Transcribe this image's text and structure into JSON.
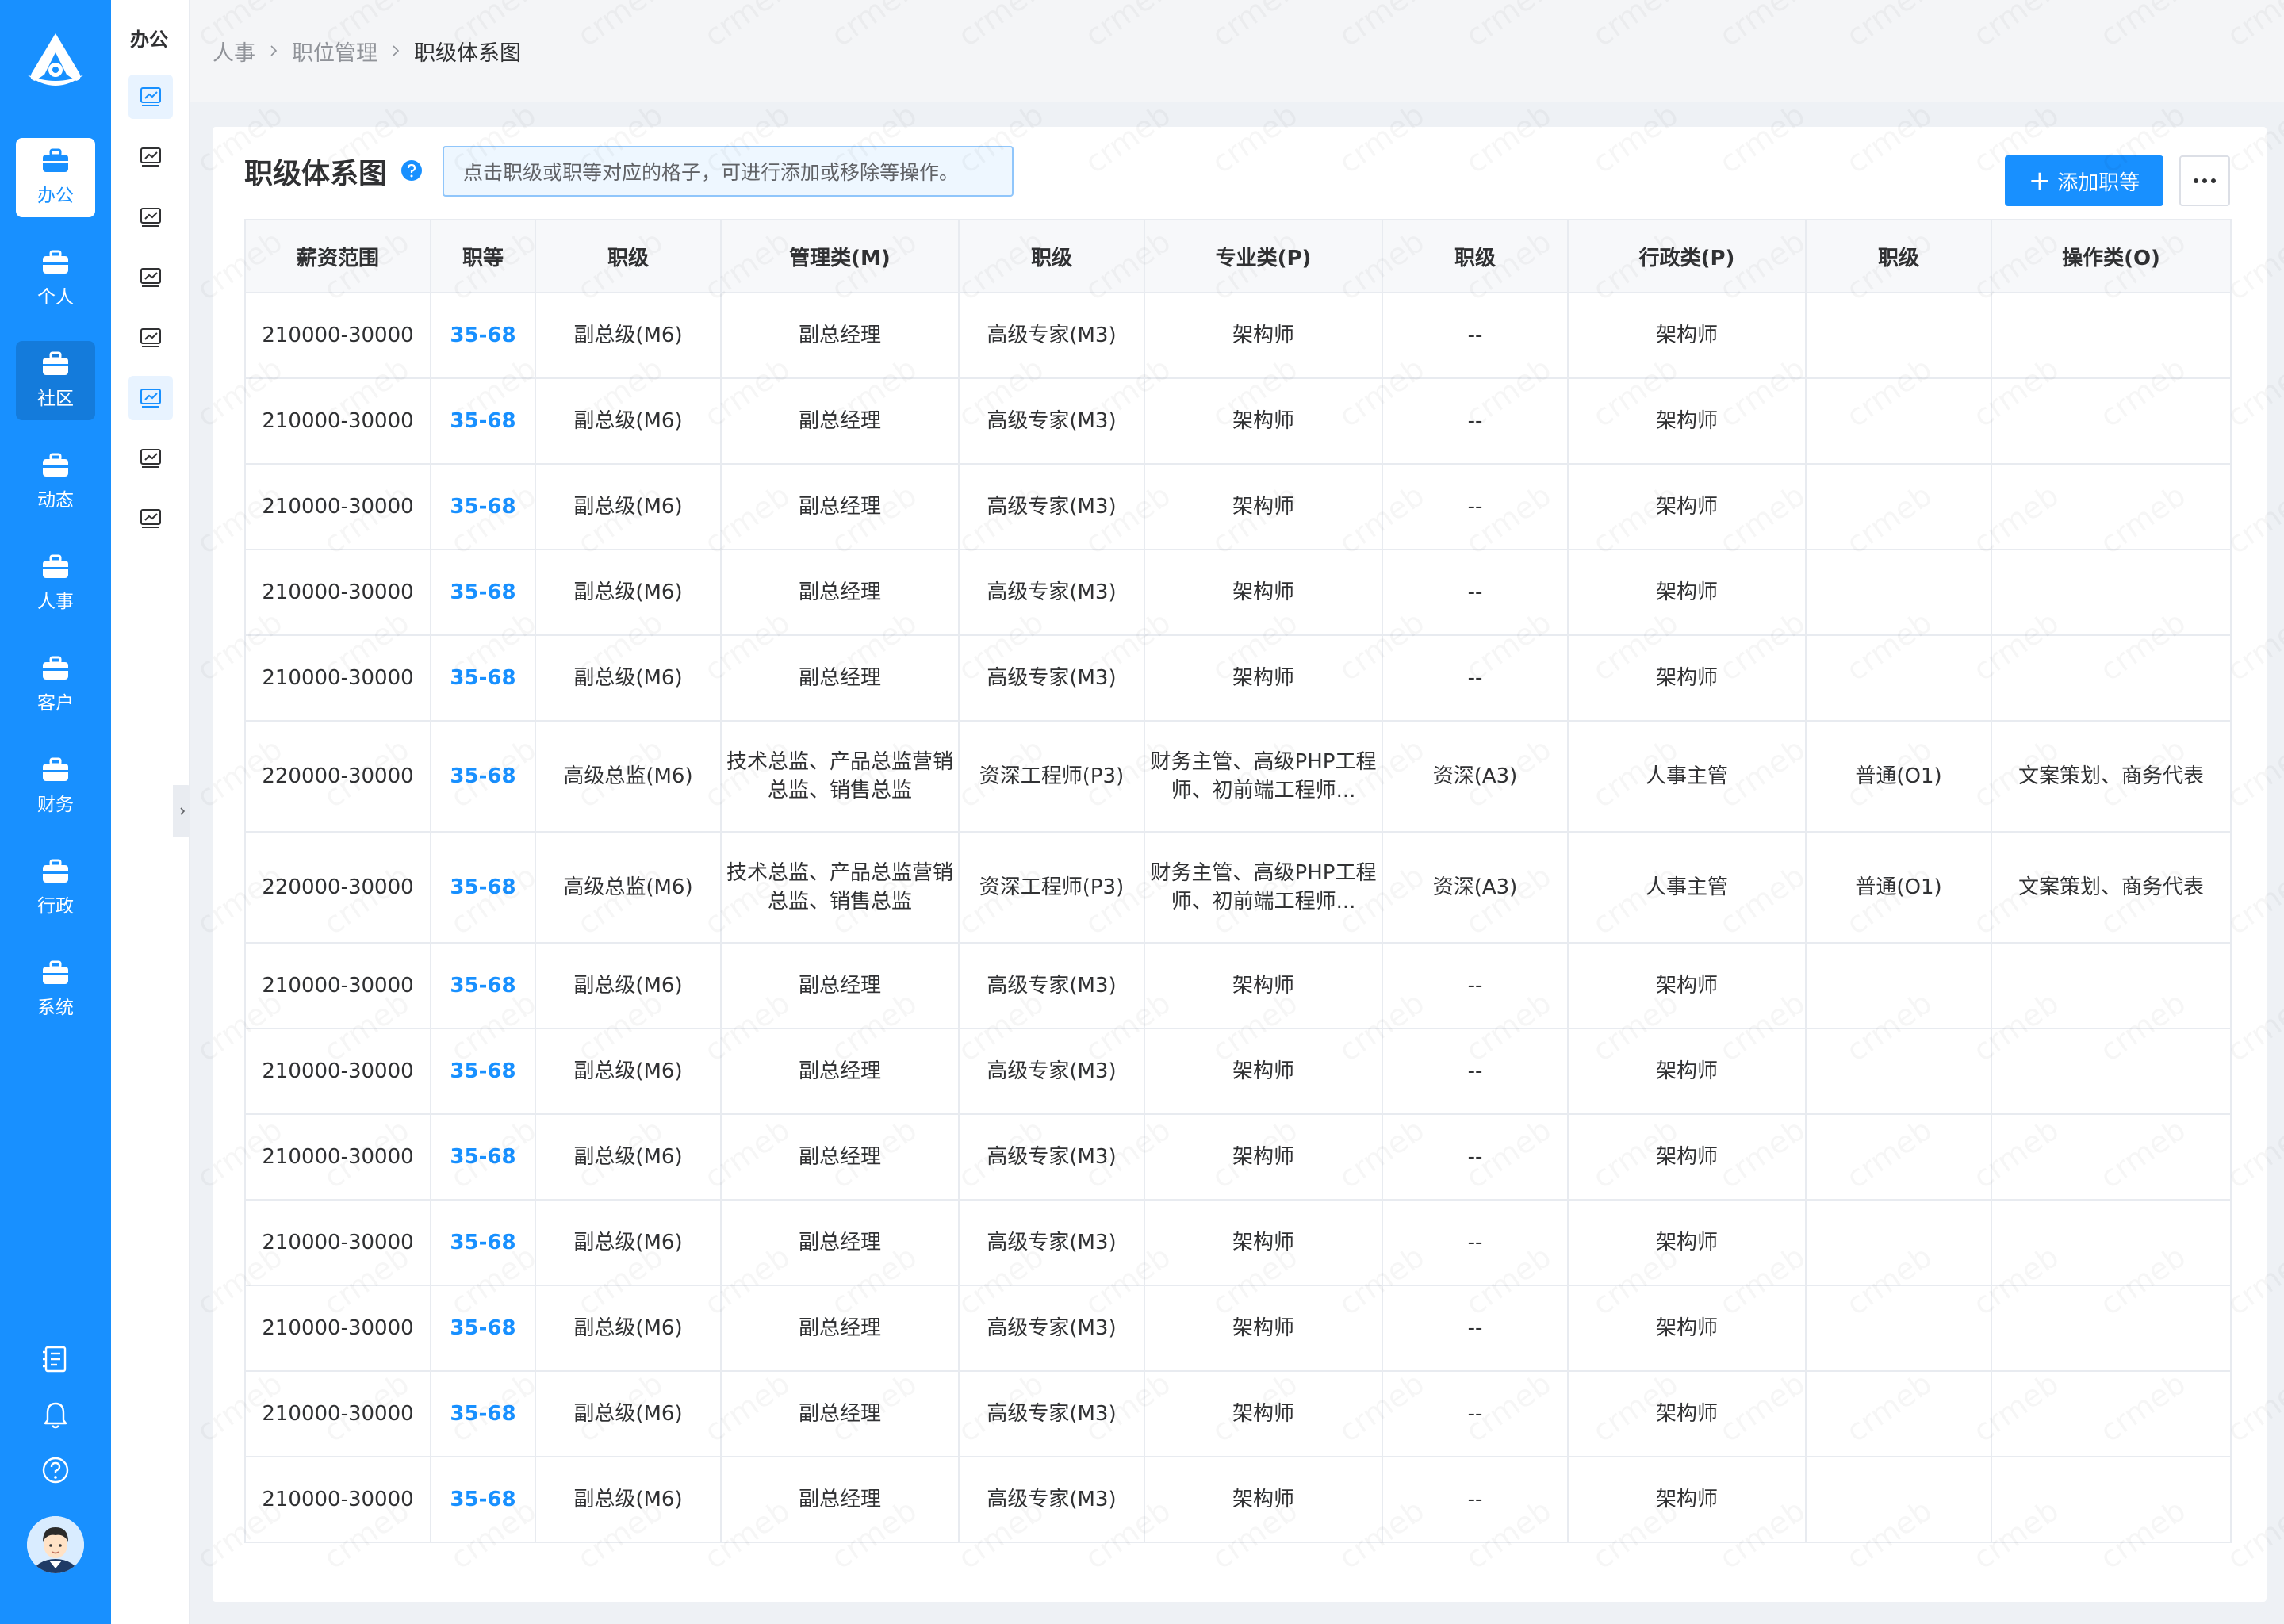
{
  "sidebar": {
    "items": [
      {
        "label": "办公",
        "state": "active"
      },
      {
        "label": "个人",
        "state": ""
      },
      {
        "label": "社区",
        "state": "hover"
      },
      {
        "label": "动态",
        "state": ""
      },
      {
        "label": "人事",
        "state": ""
      },
      {
        "label": "客户",
        "state": ""
      },
      {
        "label": "财务",
        "state": ""
      },
      {
        "label": "行政",
        "state": ""
      },
      {
        "label": "系统",
        "state": ""
      }
    ],
    "bottom_icons": [
      "document-list-icon",
      "bell-icon",
      "help-circle-icon"
    ]
  },
  "subnav": {
    "title": "办公",
    "icon": "chart-board-icon",
    "count": 8,
    "active_indexes": [
      0,
      5
    ]
  },
  "breadcrumb": [
    "人事",
    "职位管理",
    "职级体系图"
  ],
  "page": {
    "title": "职级体系图",
    "tip": "点击职级或职等对应的格子，可进行添加或移除等操作。",
    "add_button": "添加职等",
    "more_icon": "ellipsis-icon"
  },
  "table": {
    "columns": [
      "薪资范围",
      "职等",
      "职级",
      "管理类(M)",
      "职级",
      "专业类(P)",
      "职级",
      "行政类(P)",
      "职级",
      "操作类(O)"
    ],
    "rows": [
      {
        "cells": [
          "210000-30000",
          "35-68",
          "副总级(M6)",
          "副总经理",
          "高级专家(M3)",
          "架构师",
          "--",
          "架构师",
          "",
          ""
        ]
      },
      {
        "cells": [
          "210000-30000",
          "35-68",
          "副总级(M6)",
          "副总经理",
          "高级专家(M3)",
          "架构师",
          "--",
          "架构师",
          "",
          ""
        ]
      },
      {
        "cells": [
          "210000-30000",
          "35-68",
          "副总级(M6)",
          "副总经理",
          "高级专家(M3)",
          "架构师",
          "--",
          "架构师",
          "",
          ""
        ]
      },
      {
        "cells": [
          "210000-30000",
          "35-68",
          "副总级(M6)",
          "副总经理",
          "高级专家(M3)",
          "架构师",
          "--",
          "架构师",
          "",
          ""
        ]
      },
      {
        "cells": [
          "210000-30000",
          "35-68",
          "副总级(M6)",
          "副总经理",
          "高级专家(M3)",
          "架构师",
          "--",
          "架构师",
          "",
          ""
        ]
      },
      {
        "cells": [
          "220000-30000",
          "35-68",
          "高级总监(M6)",
          "技术总监、产品总监营销总监、销售总监",
          "资深工程师(P3)",
          "财务主管、高级PHP工程师、初前端工程师...",
          "资深(A3)",
          "人事主管",
          "普通(O1)",
          "文案策划、商务代表"
        ]
      },
      {
        "cells": [
          "220000-30000",
          "35-68",
          "高级总监(M6)",
          "技术总监、产品总监营销总监、销售总监",
          "资深工程师(P3)",
          "财务主管、高级PHP工程师、初前端工程师...",
          "资深(A3)",
          "人事主管",
          "普通(O1)",
          "文案策划、商务代表"
        ]
      },
      {
        "cells": [
          "210000-30000",
          "35-68",
          "副总级(M6)",
          "副总经理",
          "高级专家(M3)",
          "架构师",
          "--",
          "架构师",
          "",
          ""
        ]
      },
      {
        "cells": [
          "210000-30000",
          "35-68",
          "副总级(M6)",
          "副总经理",
          "高级专家(M3)",
          "架构师",
          "--",
          "架构师",
          "",
          ""
        ]
      },
      {
        "cells": [
          "210000-30000",
          "35-68",
          "副总级(M6)",
          "副总经理",
          "高级专家(M3)",
          "架构师",
          "--",
          "架构师",
          "",
          ""
        ]
      },
      {
        "cells": [
          "210000-30000",
          "35-68",
          "副总级(M6)",
          "副总经理",
          "高级专家(M3)",
          "架构师",
          "--",
          "架构师",
          "",
          ""
        ]
      },
      {
        "cells": [
          "210000-30000",
          "35-68",
          "副总级(M6)",
          "副总经理",
          "高级专家(M3)",
          "架构师",
          "--",
          "架构师",
          "",
          ""
        ]
      },
      {
        "cells": [
          "210000-30000",
          "35-68",
          "副总级(M6)",
          "副总经理",
          "高级专家(M3)",
          "架构师",
          "--",
          "架构师",
          "",
          ""
        ]
      },
      {
        "cells": [
          "210000-30000",
          "35-68",
          "副总级(M6)",
          "副总经理",
          "高级专家(M3)",
          "架构师",
          "--",
          "架构师",
          "",
          ""
        ]
      }
    ]
  },
  "watermark": "crmeb",
  "colors": {
    "brand": "#1890ff",
    "link": "#1890ff",
    "tip_border": "#90c6fb",
    "tip_bg": "#eef7ff"
  }
}
